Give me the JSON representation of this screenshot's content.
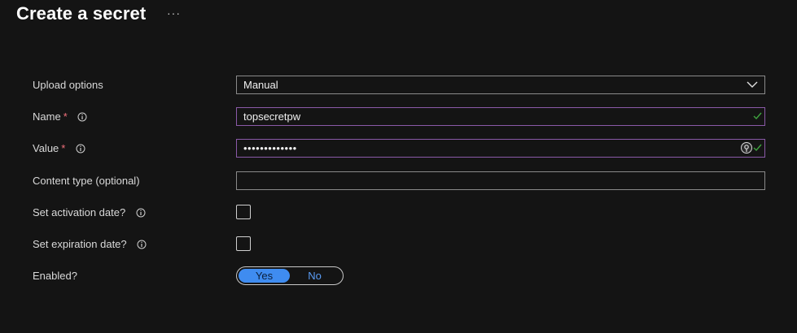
{
  "header": {
    "title": "Create a secret",
    "more_label": "···"
  },
  "form": {
    "upload_options": {
      "label": "Upload options",
      "value": "Manual"
    },
    "name": {
      "label": "Name",
      "required_mark": "*",
      "value": "topsecretpw"
    },
    "value": {
      "label": "Value",
      "required_mark": "*",
      "value": "•••••••••••••"
    },
    "content_type": {
      "label": "Content type (optional)",
      "value": ""
    },
    "activation_date": {
      "label": "Set activation date?",
      "checked": false
    },
    "expiration_date": {
      "label": "Set expiration date?",
      "checked": false
    },
    "enabled": {
      "label": "Enabled?",
      "options": [
        "Yes",
        "No"
      ],
      "selected": "Yes"
    }
  },
  "icons": {
    "info": "info-icon",
    "chevron": "chevron-down-icon",
    "check": "checkmark-icon",
    "reveal": "reveal-password-icon"
  },
  "colors": {
    "background": "#141414",
    "focus_border": "#8a5aa8",
    "required": "#f1707b",
    "valid_check": "#3fa33f",
    "toggle_selected": "#3f8cf0"
  }
}
